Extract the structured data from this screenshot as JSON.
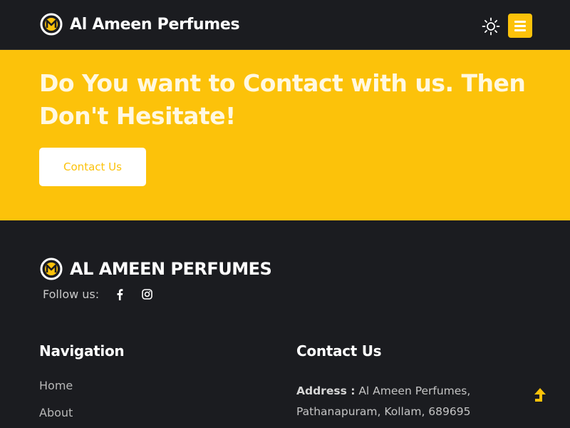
{
  "header": {
    "brand_name": "Al Ameen Perfumes",
    "logo_icon": "perfume-logo-icon",
    "theme_toggle_icon": "sun-icon",
    "menu_icon": "hamburger-menu-icon"
  },
  "cta": {
    "title": "Do You want to Contact with us. Then Don't Hesitate!",
    "button_label": "Contact Us"
  },
  "footer": {
    "brand_name": "AL AMEEN PERFUMES",
    "follow_label": "Follow us:",
    "social_icons": [
      "facebook-icon",
      "instagram-icon"
    ],
    "navigation": {
      "title": "Navigation",
      "links": [
        "Home",
        "About"
      ]
    },
    "contact": {
      "title": "Contact Us",
      "address_label": "Address :",
      "address_value": "Al Ameen Perfumes, Pathanapuram, Kollam, 689695"
    },
    "scroll_top_icon": "arrow-up-icon"
  },
  "colors": {
    "accent": "#fcc20a",
    "background": "#1b1c20",
    "text": "#ffffff",
    "muted_text": "#b8b8b8"
  }
}
